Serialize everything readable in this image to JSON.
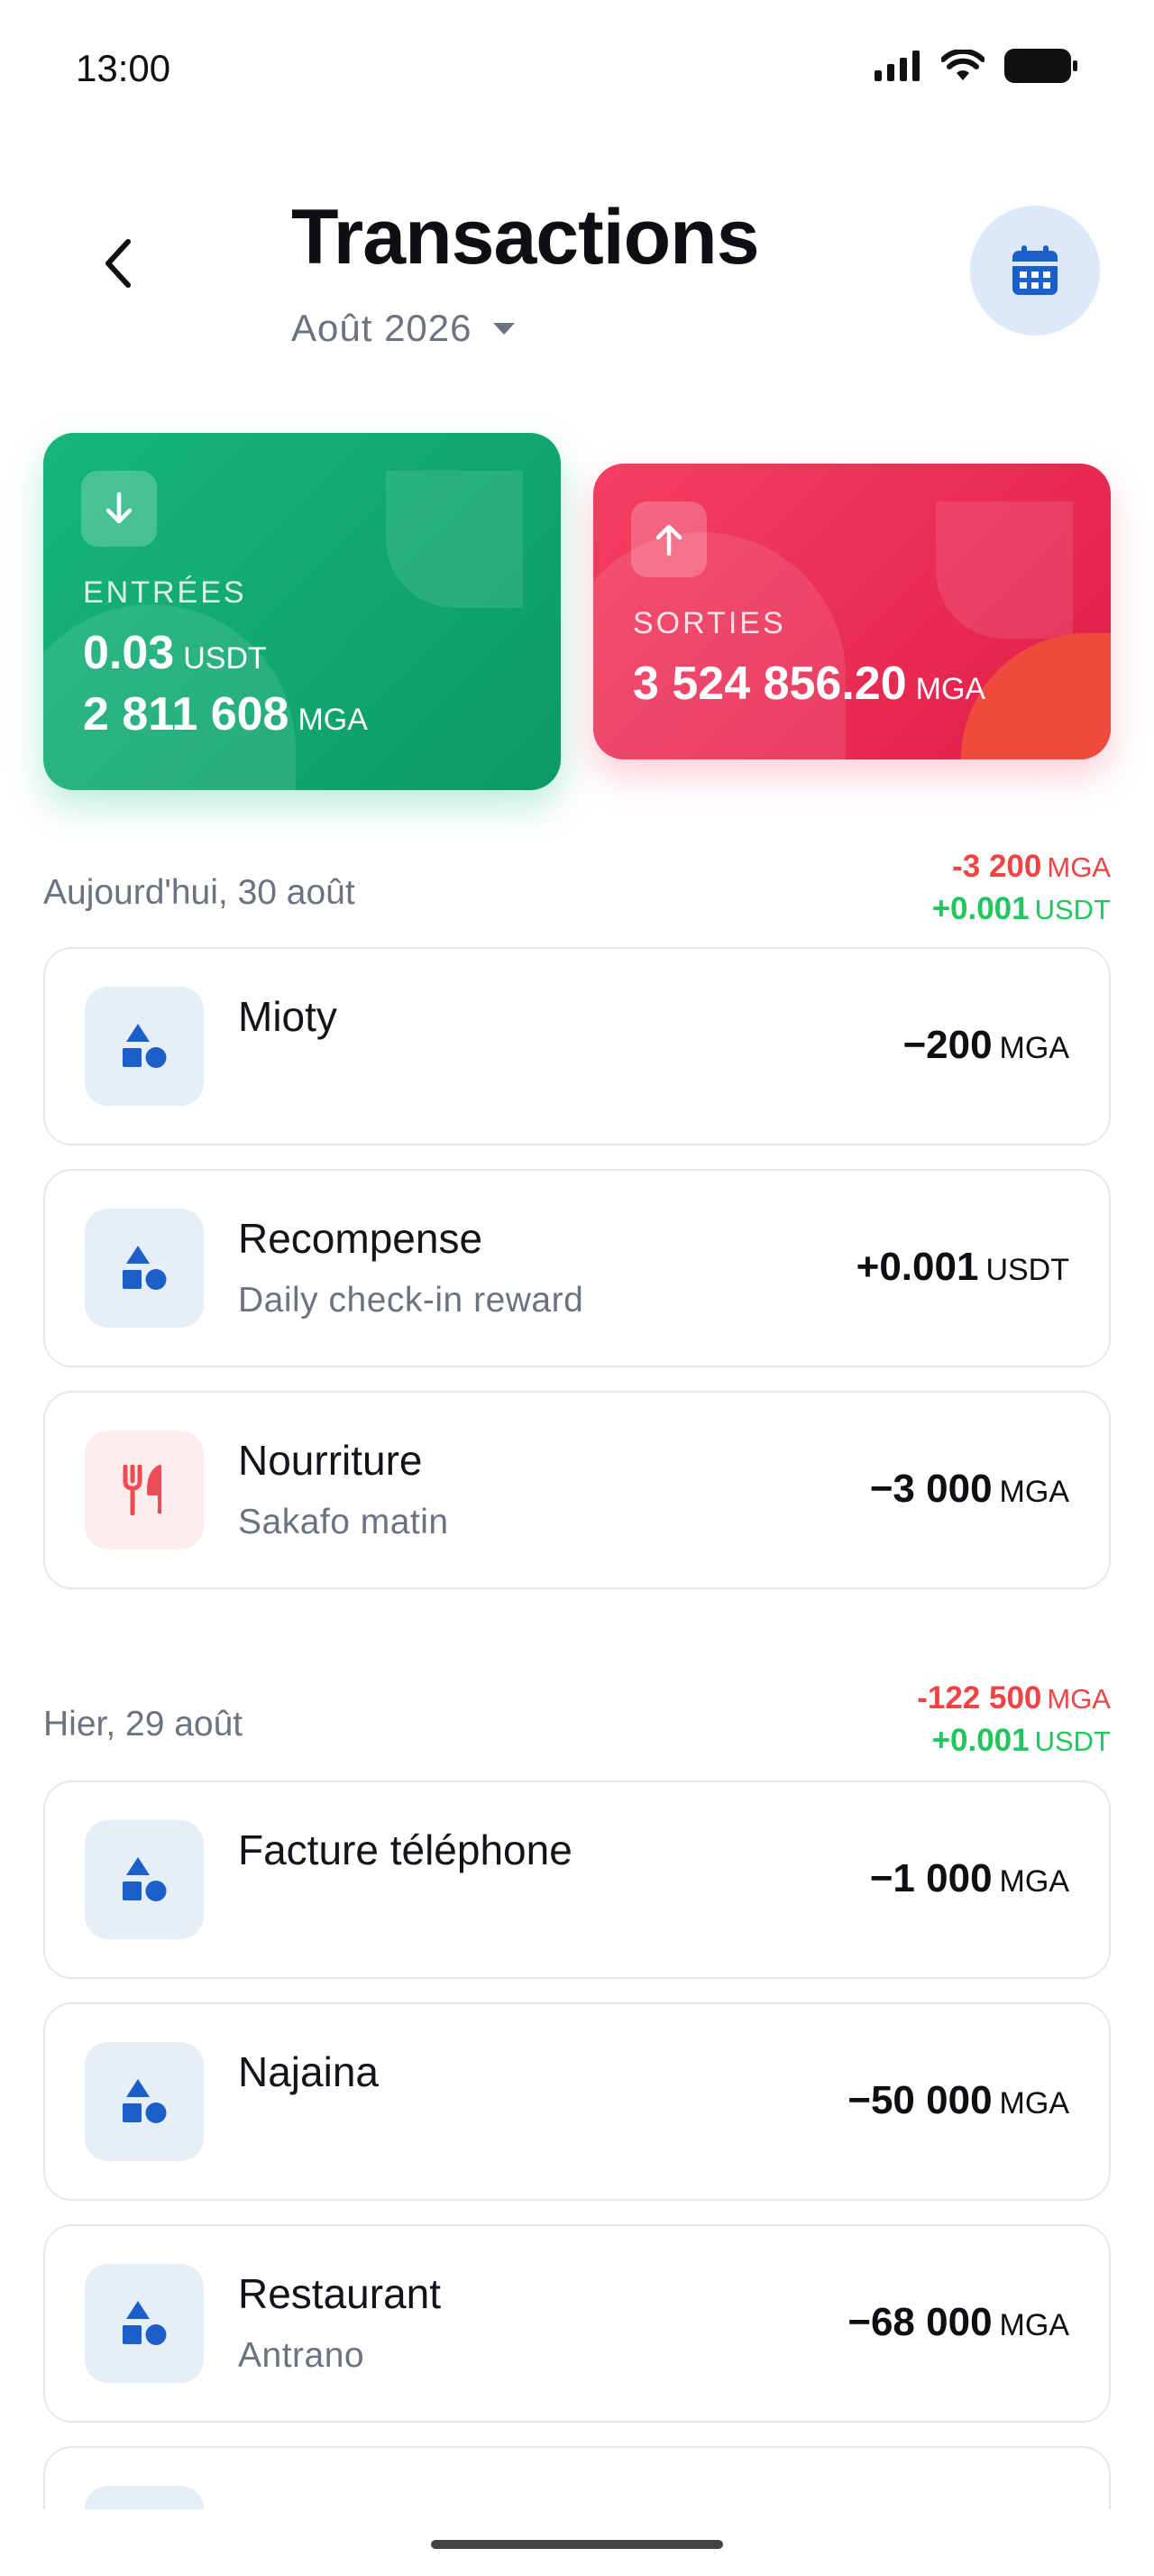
{
  "status": {
    "time": "13:00"
  },
  "header": {
    "title": "Transactions",
    "month": "Août 2026"
  },
  "cards": {
    "income": {
      "label": "ENTRÉES",
      "amount1": "0.03",
      "unit1": "USDT",
      "amount2": "2 811 608",
      "unit2": "MGA"
    },
    "expense": {
      "label": "SORTIES",
      "amount": "3 524 856.20",
      "unit": "MGA"
    }
  },
  "sections": [
    {
      "date": "Aujourd'hui, 30 août",
      "total_out": "-3 200",
      "total_out_unit": "MGA",
      "total_in": "+0.001",
      "total_in_unit": "USDT",
      "items": [
        {
          "title": "Mioty",
          "subtitle": "",
          "amount": "−200",
          "unit": "MGA",
          "icon": "shapes-icon"
        },
        {
          "title": "Recompense",
          "subtitle": "Daily check-in reward",
          "amount": "+0.001",
          "unit": "USDT",
          "icon": "shapes-icon"
        },
        {
          "title": "Nourriture",
          "subtitle": "Sakafo matin",
          "amount": "−3 000",
          "unit": "MGA",
          "icon": "fork-knife-icon"
        }
      ]
    },
    {
      "date": "Hier, 29 août",
      "total_out": "-122 500",
      "total_out_unit": "MGA",
      "total_in": "+0.001",
      "total_in_unit": "USDT",
      "items": [
        {
          "title": "Facture téléphone",
          "subtitle": "",
          "amount": "−1 000",
          "unit": "MGA",
          "icon": "shapes-icon"
        },
        {
          "title": "Najaina",
          "subtitle": "",
          "amount": "−50 000",
          "unit": "MGA",
          "icon": "shapes-icon"
        },
        {
          "title": "Restaurant",
          "subtitle": "Antrano",
          "amount": "−68 000",
          "unit": "MGA",
          "icon": "shapes-icon"
        }
      ]
    }
  ],
  "colors": {
    "income": "#10b981",
    "expense": "#f43f5e",
    "accent": "#1d5fc9",
    "negative": "#ef4444",
    "positive": "#22c55e"
  }
}
